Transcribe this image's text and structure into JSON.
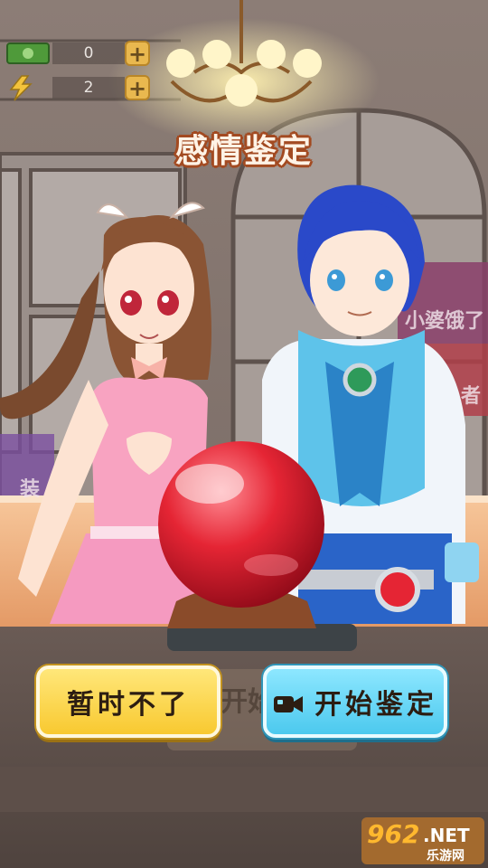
{
  "hud": {
    "cash_value": "0",
    "energy_value": "2",
    "plus_label": "+"
  },
  "title": "感情鉴定",
  "background_signs": {
    "sign_right_1": "小婆饿了",
    "sign_right_2": "者",
    "sign_left_1": "装",
    "faint_button_text": "开始"
  },
  "buttons": {
    "decline_label": "暂时不了",
    "start_label": "开始鉴定"
  },
  "watermark": {
    "number": "962",
    "suffix": ".NET",
    "subtitle": "乐游网"
  },
  "colors": {
    "title_outline": "#a34b22",
    "decline_button": "#f8c930",
    "start_button": "#4cc9ee",
    "crystal_ball": "#d81e2c"
  },
  "icons": {
    "cash": "cash-icon",
    "energy": "lightning-icon",
    "video": "video-camera-icon"
  }
}
